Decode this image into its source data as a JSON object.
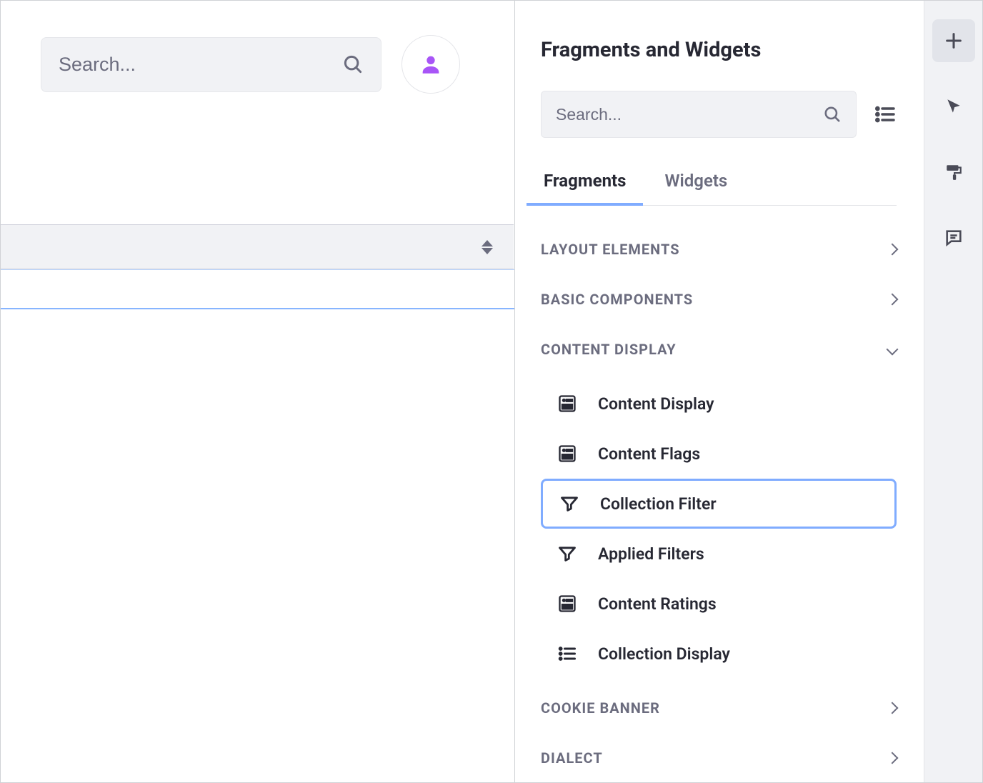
{
  "main": {
    "search_placeholder": "Search..."
  },
  "panel": {
    "title": "Fragments and Widgets",
    "search_placeholder": "Search...",
    "tabs": [
      {
        "label": "Fragments",
        "active": true
      },
      {
        "label": "Widgets",
        "active": false
      }
    ],
    "categories": [
      {
        "label": "LAYOUT ELEMENTS",
        "open": false
      },
      {
        "label": "BASIC COMPONENTS",
        "open": false
      },
      {
        "label": "CONTENT DISPLAY",
        "open": true
      },
      {
        "label": "COOKIE BANNER",
        "open": false
      },
      {
        "label": "DIALECT",
        "open": false
      }
    ],
    "content_display_items": [
      {
        "label": "Content Display",
        "icon": "content"
      },
      {
        "label": "Content Flags",
        "icon": "content"
      },
      {
        "label": "Collection Filter",
        "icon": "filter",
        "selected": true
      },
      {
        "label": "Applied Filters",
        "icon": "filter"
      },
      {
        "label": "Content Ratings",
        "icon": "content"
      },
      {
        "label": "Collection Display",
        "icon": "list"
      }
    ]
  }
}
